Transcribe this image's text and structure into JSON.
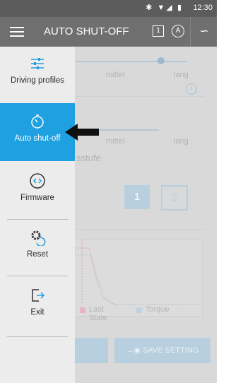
{
  "status": {
    "time": "12:30",
    "icons": "✱ ▼◢ ▮"
  },
  "appbar": {
    "title": "AUTO SHUT-OFF",
    "icon1_text": "1",
    "icon2_text": "A",
    "icon3_text": "∽"
  },
  "drawer": {
    "items": [
      {
        "label": "Driving profiles",
        "icon": "sliders-icon"
      },
      {
        "label": "Auto shut-off",
        "icon": "timer-icon",
        "active": true
      },
      {
        "label": "Firmware",
        "icon": "code-icon"
      },
      {
        "label": "Reset",
        "icon": "gear-reset-icon"
      },
      {
        "label": "Exit",
        "icon": "exit-icon"
      }
    ]
  },
  "background": {
    "slider1_labels": [
      "mittel",
      "lang"
    ],
    "slider2_labels": [
      "mittel",
      "lang"
    ],
    "stufe_label": "sstufe",
    "level_buttons": [
      "1",
      "2"
    ],
    "legend": {
      "last": "Last State",
      "torque": "Torque"
    },
    "save_label": "SAVE SETTING",
    "save_icon_text": "→◉"
  },
  "colors": {
    "accent": "#1fa0e0",
    "appbar": "#6f6f6f",
    "statusbar": "#5c5c5c"
  }
}
